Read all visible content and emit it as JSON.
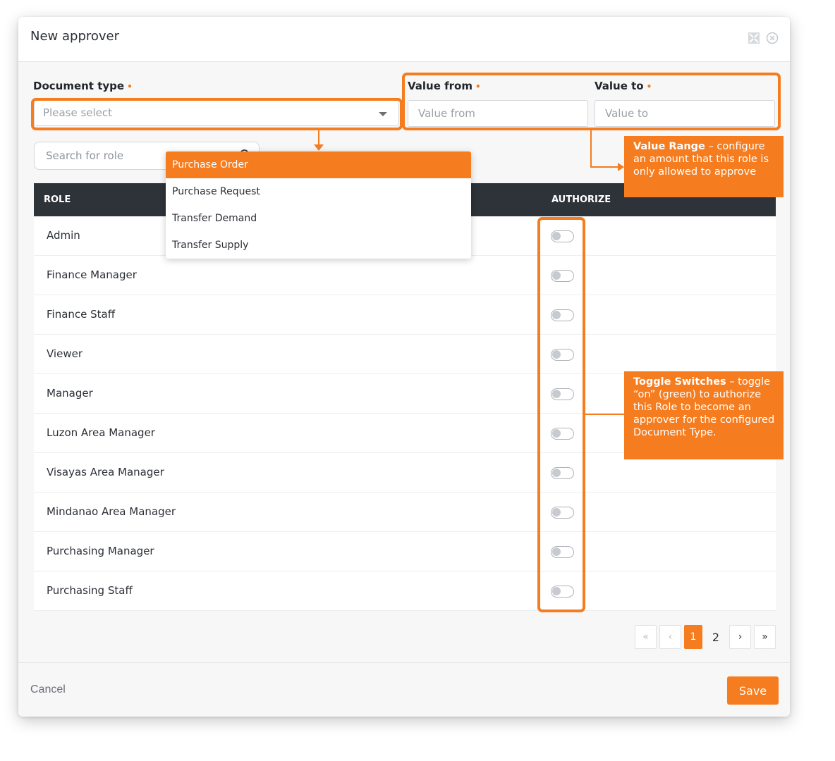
{
  "modal": {
    "title": "New approver"
  },
  "form": {
    "document_type_label": "Document type",
    "document_type_placeholder": "Please select",
    "value_from_label": "Value from",
    "value_from_placeholder": "Value from",
    "value_to_label": "Value to",
    "value_to_placeholder": "Value to",
    "required_marker": "•",
    "search_placeholder": "Search for role"
  },
  "dropdown": {
    "options": [
      "Purchase Order",
      "Purchase Request",
      "Transfer Demand",
      "Transfer Supply"
    ],
    "highlighted": "Purchase Order"
  },
  "table": {
    "headers": {
      "role": "ROLE",
      "authorize": "AUTHORIZE"
    },
    "rows": [
      {
        "role": "Admin",
        "authorized": false
      },
      {
        "role": "Finance Manager",
        "authorized": false
      },
      {
        "role": "Finance Staff",
        "authorized": false
      },
      {
        "role": "Viewer",
        "authorized": false
      },
      {
        "role": "Manager",
        "authorized": false
      },
      {
        "role": "Luzon Area Manager",
        "authorized": false
      },
      {
        "role": "Visayas Area Manager",
        "authorized": false
      },
      {
        "role": "Mindanao Area Manager",
        "authorized": false
      },
      {
        "role": "Purchasing Manager",
        "authorized": false
      },
      {
        "role": "Purchasing Staff",
        "authorized": false
      }
    ]
  },
  "pagination": {
    "first": "«",
    "prev": "‹",
    "pages": [
      "1",
      "2"
    ],
    "current": "1",
    "next": "›",
    "last": "»"
  },
  "footer": {
    "cancel_label": "Cancel",
    "save_label": "Save"
  },
  "annotations": {
    "value_range_title": "Value Range",
    "value_range_text": " – configure an amount that this role is only allowed to approve",
    "toggle_title": "Toggle Switches",
    "toggle_text": " – toggle “on” (green) to authorize this Role to become an approver for the configured Document Type."
  },
  "colors": {
    "accent": "#f57c1f",
    "header_dark": "#2e3239"
  },
  "icons": [
    "expand-icon",
    "close-circle-icon",
    "search-icon",
    "chevron-down-icon"
  ]
}
